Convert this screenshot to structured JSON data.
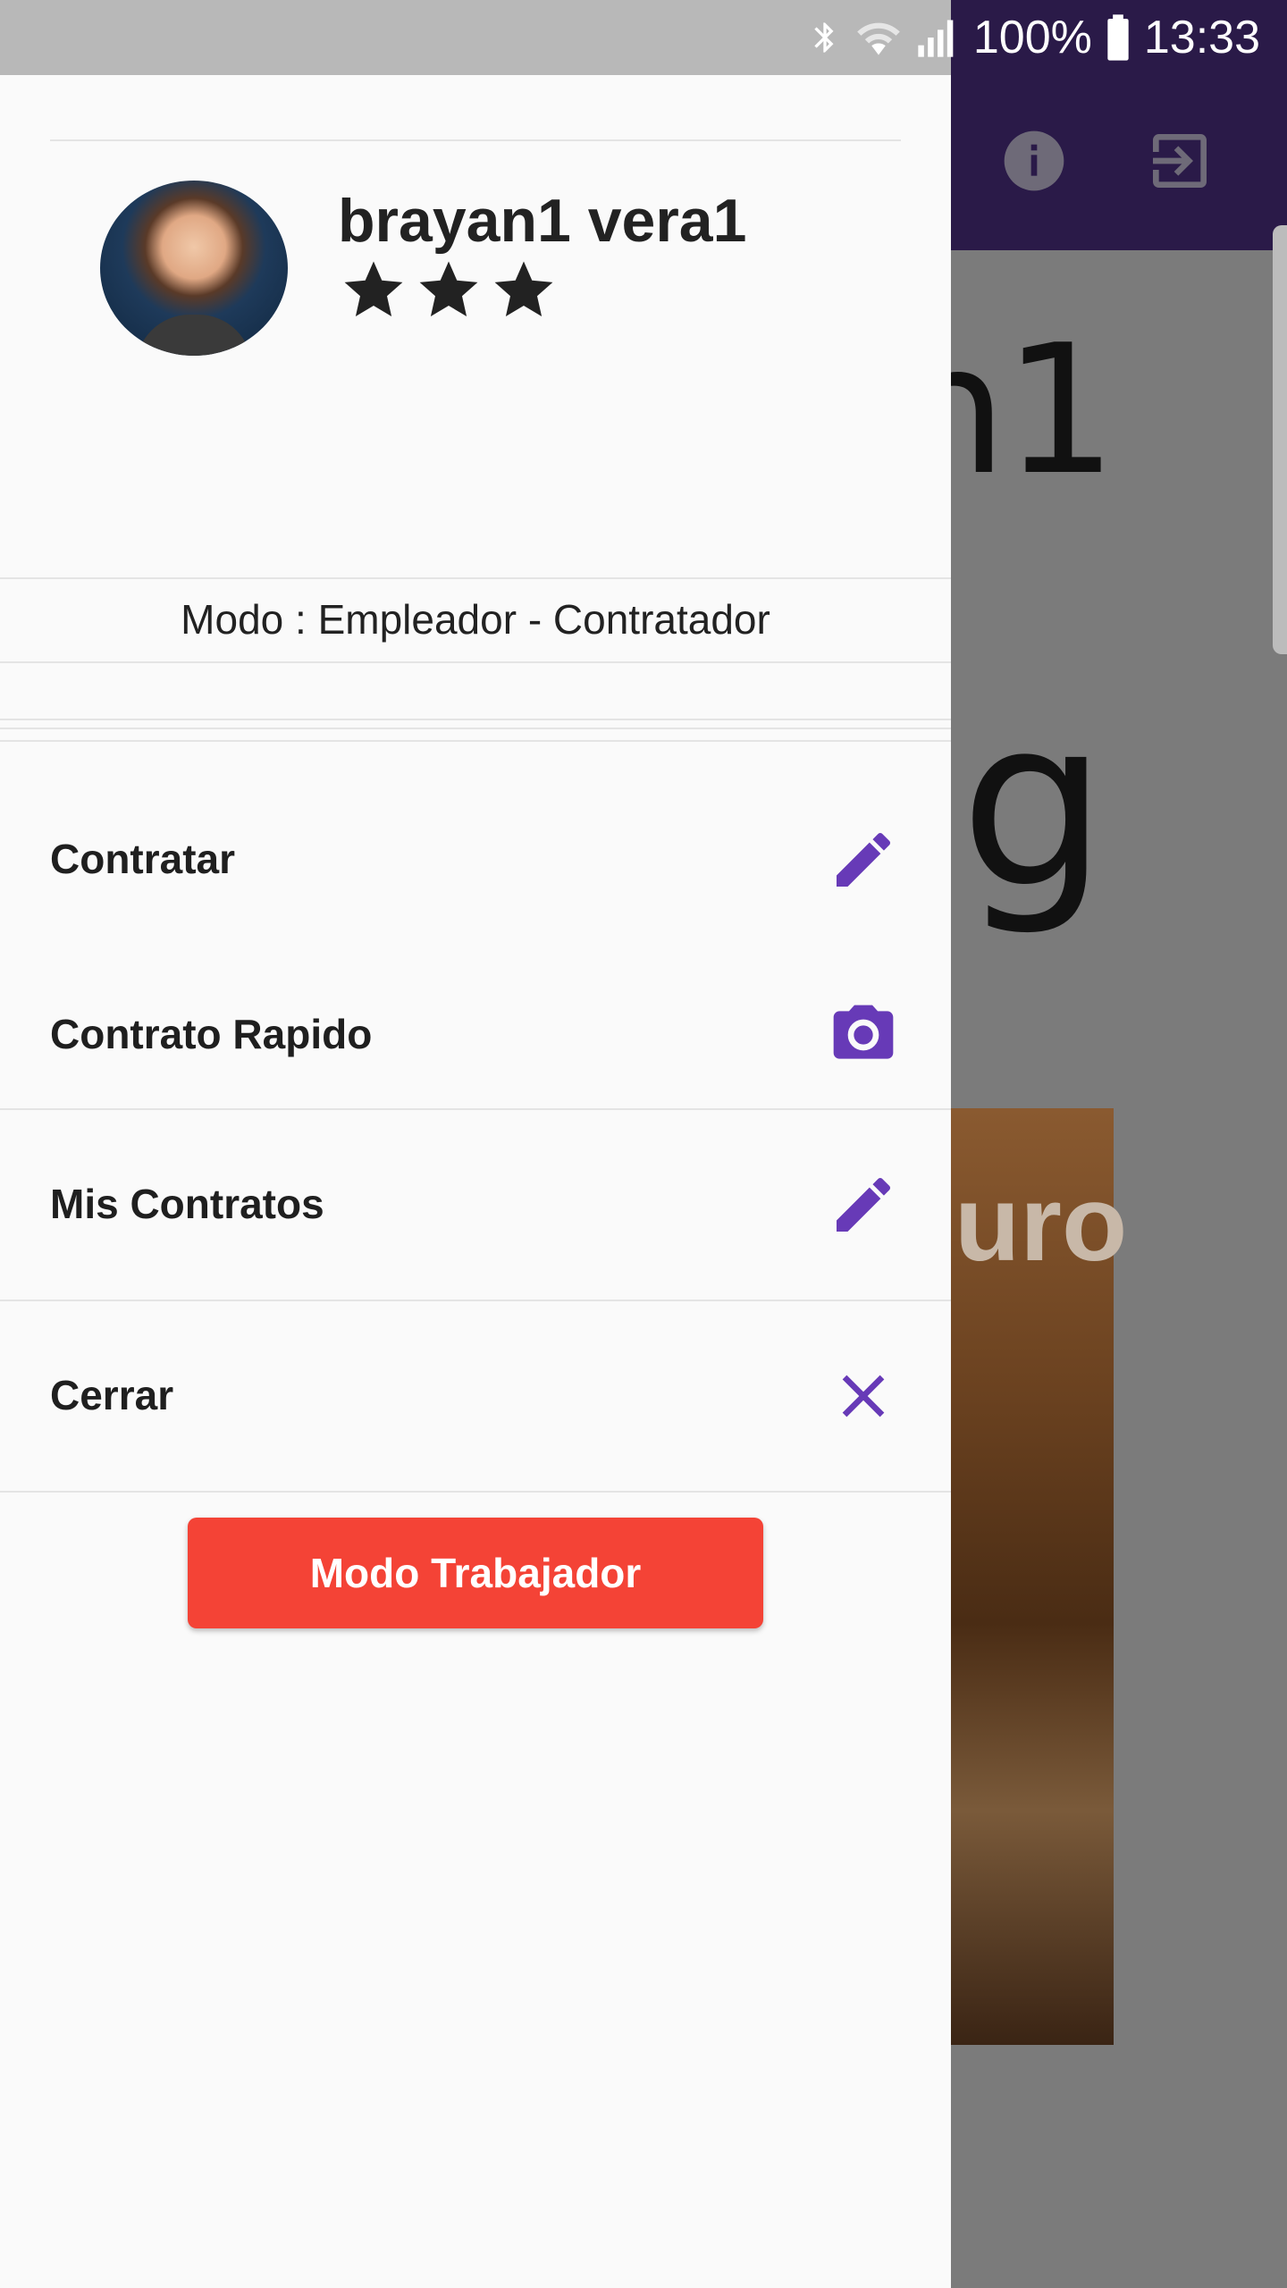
{
  "status_bar": {
    "battery": "100%",
    "time": "13:33"
  },
  "background": {
    "big_text_1": "n1",
    "big_text_2": "g",
    "image_text": "uro"
  },
  "drawer": {
    "user": {
      "name": "brayan1 vera1",
      "rating_stars": 3
    },
    "mode_label": "Modo : Empleador - Contratador",
    "menu": [
      {
        "label": "Contratar",
        "icon": "pencil-icon"
      },
      {
        "label": "Contrato Rapido",
        "icon": "camera-icon"
      },
      {
        "label": "Mis Contratos",
        "icon": "pencil-icon"
      },
      {
        "label": "Cerrar",
        "icon": "close-icon"
      }
    ],
    "mode_button": "Modo Trabajador"
  },
  "colors": {
    "accent": "#673ab7",
    "button": "#f44336",
    "toolbar": "#2a1a48"
  }
}
